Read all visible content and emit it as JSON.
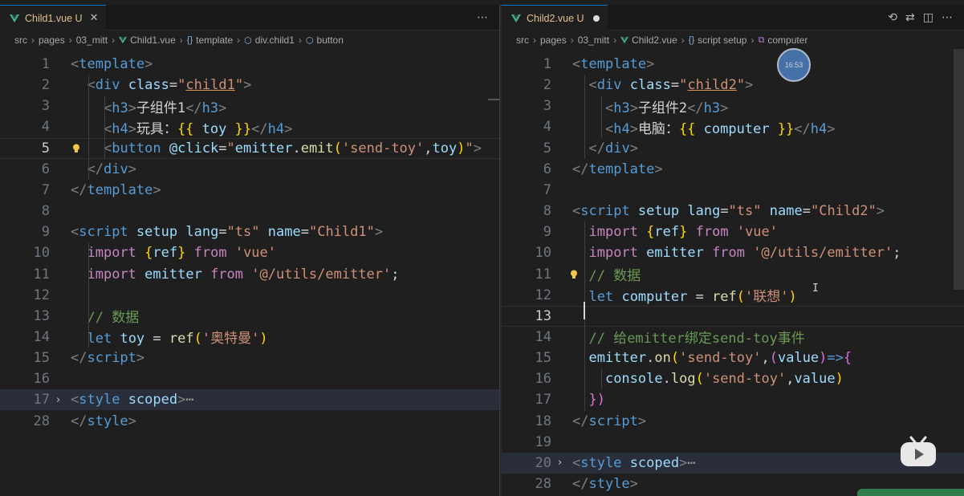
{
  "left": {
    "tab": {
      "label": "Child1.vue U",
      "close": "✕"
    },
    "actions": [
      "⋯"
    ],
    "breadcrumb": [
      {
        "label": "src"
      },
      {
        "label": "pages"
      },
      {
        "label": "03_mitt"
      },
      {
        "label": "Child1.vue",
        "icon": "vue"
      },
      {
        "label": "template",
        "icon": "{}"
      },
      {
        "label": "div.child1",
        "icon": "cube"
      },
      {
        "label": "button",
        "icon": "cube"
      }
    ],
    "lines": [
      {
        "n": "1",
        "tokens": [
          [
            "t-punc",
            "<"
          ],
          [
            "t-tag",
            "template"
          ],
          [
            "t-punc",
            ">"
          ]
        ]
      },
      {
        "n": "2",
        "tokens": [
          [
            "t-txt",
            "  "
          ],
          [
            "t-punc",
            "<"
          ],
          [
            "t-tag",
            "div"
          ],
          [
            "t-txt",
            " "
          ],
          [
            "t-attr",
            "class"
          ],
          [
            "t-txt",
            "="
          ],
          [
            "t-str",
            "\""
          ],
          [
            "t-str u-err",
            "child1"
          ],
          [
            "t-str",
            "\""
          ],
          [
            "t-punc",
            ">"
          ]
        ]
      },
      {
        "n": "3",
        "tokens": [
          [
            "t-txt",
            "    "
          ],
          [
            "t-punc",
            "<"
          ],
          [
            "t-tag",
            "h3"
          ],
          [
            "t-punc",
            ">"
          ],
          [
            "t-txt",
            "子组件1"
          ],
          [
            "t-punc",
            "</"
          ],
          [
            "t-tag",
            "h3"
          ],
          [
            "t-punc",
            ">"
          ]
        ]
      },
      {
        "n": "4",
        "tokens": [
          [
            "t-txt",
            "    "
          ],
          [
            "t-punc",
            "<"
          ],
          [
            "t-tag",
            "h4"
          ],
          [
            "t-punc",
            ">"
          ],
          [
            "t-txt",
            "玩具："
          ],
          [
            "t-brace",
            "{{"
          ],
          [
            "t-txt",
            " "
          ],
          [
            "t-var",
            "toy"
          ],
          [
            "t-txt",
            " "
          ],
          [
            "t-brace",
            "}}"
          ],
          [
            "t-punc",
            "</"
          ],
          [
            "t-tag",
            "h4"
          ],
          [
            "t-punc",
            ">"
          ]
        ]
      },
      {
        "n": "5",
        "tokens": [
          [
            "t-txt",
            "    "
          ],
          [
            "t-punc",
            "<"
          ],
          [
            "t-tag",
            "button"
          ],
          [
            "t-txt",
            " "
          ],
          [
            "t-attr",
            "@click"
          ],
          [
            "t-txt",
            "="
          ],
          [
            "t-str",
            "\""
          ],
          [
            "t-var",
            "emitter"
          ],
          [
            "t-txt",
            "."
          ],
          [
            "t-fn",
            "emit"
          ],
          [
            "t-brace",
            "("
          ],
          [
            "t-str",
            "'send-toy'"
          ],
          [
            "t-txt",
            ","
          ],
          [
            "t-var",
            "toy"
          ],
          [
            "t-brace",
            ")"
          ],
          [
            "t-str",
            "\""
          ],
          [
            "t-punc",
            ">"
          ]
        ]
      },
      {
        "n": "6",
        "tokens": [
          [
            "t-txt",
            "  "
          ],
          [
            "t-punc",
            "</"
          ],
          [
            "t-tag",
            "div"
          ],
          [
            "t-punc",
            ">"
          ]
        ]
      },
      {
        "n": "7",
        "tokens": [
          [
            "t-punc",
            "</"
          ],
          [
            "t-tag",
            "template"
          ],
          [
            "t-punc",
            ">"
          ]
        ]
      },
      {
        "n": "8",
        "tokens": []
      },
      {
        "n": "9",
        "tokens": [
          [
            "t-punc",
            "<"
          ],
          [
            "t-tag",
            "script"
          ],
          [
            "t-txt",
            " "
          ],
          [
            "t-attr",
            "setup"
          ],
          [
            "t-txt",
            " "
          ],
          [
            "t-attr",
            "lang"
          ],
          [
            "t-txt",
            "="
          ],
          [
            "t-str",
            "\"ts\""
          ],
          [
            "t-txt",
            " "
          ],
          [
            "t-attr",
            "name"
          ],
          [
            "t-txt",
            "="
          ],
          [
            "t-str",
            "\"Child1\""
          ],
          [
            "t-punc",
            ">"
          ]
        ]
      },
      {
        "n": "10",
        "tokens": [
          [
            "t-txt",
            "  "
          ],
          [
            "t-kw2",
            "import"
          ],
          [
            "t-txt",
            " "
          ],
          [
            "t-brace",
            "{"
          ],
          [
            "t-var",
            "ref"
          ],
          [
            "t-brace",
            "}"
          ],
          [
            "t-txt",
            " "
          ],
          [
            "t-kw2",
            "from"
          ],
          [
            "t-txt",
            " "
          ],
          [
            "t-str",
            "'vue'"
          ]
        ]
      },
      {
        "n": "11",
        "tokens": [
          [
            "t-txt",
            "  "
          ],
          [
            "t-kw2",
            "import"
          ],
          [
            "t-txt",
            " "
          ],
          [
            "t-var",
            "emitter"
          ],
          [
            "t-txt",
            " "
          ],
          [
            "t-kw2",
            "from"
          ],
          [
            "t-txt",
            " "
          ],
          [
            "t-str",
            "'@/utils/emitter'"
          ],
          [
            "t-txt",
            ";"
          ]
        ]
      },
      {
        "n": "12",
        "tokens": []
      },
      {
        "n": "13",
        "tokens": [
          [
            "t-txt",
            "  "
          ],
          [
            "t-com",
            "// 数据"
          ]
        ]
      },
      {
        "n": "14",
        "tokens": [
          [
            "t-txt",
            "  "
          ],
          [
            "t-kw",
            "let"
          ],
          [
            "t-txt",
            " "
          ],
          [
            "t-var",
            "toy"
          ],
          [
            "t-txt",
            " = "
          ],
          [
            "t-fn",
            "ref"
          ],
          [
            "t-brace",
            "("
          ],
          [
            "t-str",
            "'奥特曼'"
          ],
          [
            "t-brace",
            ")"
          ]
        ]
      },
      {
        "n": "15",
        "tokens": [
          [
            "t-punc",
            "</"
          ],
          [
            "t-tag",
            "script"
          ],
          [
            "t-punc",
            ">"
          ]
        ]
      },
      {
        "n": "16",
        "tokens": []
      },
      {
        "n": "17",
        "tokens": [
          [
            "t-punc",
            "<"
          ],
          [
            "t-tag",
            "style"
          ],
          [
            "t-txt",
            " "
          ],
          [
            "t-attr",
            "scoped"
          ],
          [
            "t-punc",
            ">"
          ],
          [
            "t-ellipsis",
            "⋯"
          ]
        ]
      },
      {
        "n": "28",
        "tokens": [
          [
            "t-punc",
            "</"
          ],
          [
            "t-tag",
            "style"
          ],
          [
            "t-punc",
            ">"
          ]
        ]
      }
    ]
  },
  "right": {
    "tab": {
      "label": "Child2.vue U"
    },
    "actions": [
      "⟲",
      "⇄",
      "◫",
      "⋯"
    ],
    "breadcrumb": [
      {
        "label": "src"
      },
      {
        "label": "pages"
      },
      {
        "label": "03_mitt"
      },
      {
        "label": "Child2.vue",
        "icon": "vue"
      },
      {
        "label": "script setup",
        "icon": "{}"
      },
      {
        "label": "computer",
        "icon": "var"
      }
    ],
    "lines": [
      {
        "n": "1",
        "tokens": [
          [
            "t-punc",
            "<"
          ],
          [
            "t-tag",
            "template"
          ],
          [
            "t-punc",
            ">"
          ]
        ]
      },
      {
        "n": "2",
        "tokens": [
          [
            "t-txt",
            "  "
          ],
          [
            "t-punc",
            "<"
          ],
          [
            "t-tag",
            "div"
          ],
          [
            "t-txt",
            " "
          ],
          [
            "t-attr",
            "class"
          ],
          [
            "t-txt",
            "="
          ],
          [
            "t-str",
            "\""
          ],
          [
            "t-str u-err",
            "child2"
          ],
          [
            "t-str",
            "\""
          ],
          [
            "t-punc",
            ">"
          ]
        ]
      },
      {
        "n": "3",
        "tokens": [
          [
            "t-txt",
            "    "
          ],
          [
            "t-punc",
            "<"
          ],
          [
            "t-tag",
            "h3"
          ],
          [
            "t-punc",
            ">"
          ],
          [
            "t-txt",
            "子组件2"
          ],
          [
            "t-punc",
            "</"
          ],
          [
            "t-tag",
            "h3"
          ],
          [
            "t-punc",
            ">"
          ]
        ]
      },
      {
        "n": "4",
        "tokens": [
          [
            "t-txt",
            "    "
          ],
          [
            "t-punc",
            "<"
          ],
          [
            "t-tag",
            "h4"
          ],
          [
            "t-punc",
            ">"
          ],
          [
            "t-txt",
            "电脑："
          ],
          [
            "t-brace",
            "{{"
          ],
          [
            "t-txt",
            " "
          ],
          [
            "t-var",
            "computer"
          ],
          [
            "t-txt",
            " "
          ],
          [
            "t-brace",
            "}}"
          ],
          [
            "t-punc",
            "</"
          ],
          [
            "t-tag",
            "h4"
          ],
          [
            "t-punc",
            ">"
          ]
        ]
      },
      {
        "n": "5",
        "tokens": [
          [
            "t-txt",
            "  "
          ],
          [
            "t-punc",
            "</"
          ],
          [
            "t-tag",
            "div"
          ],
          [
            "t-punc",
            ">"
          ]
        ]
      },
      {
        "n": "6",
        "tokens": [
          [
            "t-punc",
            "</"
          ],
          [
            "t-tag",
            "template"
          ],
          [
            "t-punc",
            ">"
          ]
        ]
      },
      {
        "n": "7",
        "tokens": []
      },
      {
        "n": "8",
        "tokens": [
          [
            "t-punc",
            "<"
          ],
          [
            "t-tag",
            "script"
          ],
          [
            "t-txt",
            " "
          ],
          [
            "t-attr",
            "setup"
          ],
          [
            "t-txt",
            " "
          ],
          [
            "t-attr",
            "lang"
          ],
          [
            "t-txt",
            "="
          ],
          [
            "t-str",
            "\"ts\""
          ],
          [
            "t-txt",
            " "
          ],
          [
            "t-attr",
            "name"
          ],
          [
            "t-txt",
            "="
          ],
          [
            "t-str",
            "\"Child2\""
          ],
          [
            "t-punc",
            ">"
          ]
        ]
      },
      {
        "n": "9",
        "tokens": [
          [
            "t-txt",
            "  "
          ],
          [
            "t-kw2",
            "import"
          ],
          [
            "t-txt",
            " "
          ],
          [
            "t-brace",
            "{"
          ],
          [
            "t-var",
            "ref"
          ],
          [
            "t-brace",
            "}"
          ],
          [
            "t-txt",
            " "
          ],
          [
            "t-kw2",
            "from"
          ],
          [
            "t-txt",
            " "
          ],
          [
            "t-str",
            "'vue'"
          ]
        ]
      },
      {
        "n": "10",
        "tokens": [
          [
            "t-txt",
            "  "
          ],
          [
            "t-kw2",
            "import"
          ],
          [
            "t-txt",
            " "
          ],
          [
            "t-var",
            "emitter"
          ],
          [
            "t-txt",
            " "
          ],
          [
            "t-kw2",
            "from"
          ],
          [
            "t-txt",
            " "
          ],
          [
            "t-str",
            "'@/utils/emitter'"
          ],
          [
            "t-txt",
            ";"
          ]
        ]
      },
      {
        "n": "11",
        "tokens": [
          [
            "t-txt",
            "  "
          ],
          [
            "t-com",
            "// 数据"
          ]
        ]
      },
      {
        "n": "12",
        "tokens": [
          [
            "t-txt",
            "  "
          ],
          [
            "t-kw",
            "let"
          ],
          [
            "t-txt",
            " "
          ],
          [
            "t-var",
            "computer"
          ],
          [
            "t-txt",
            " = "
          ],
          [
            "t-fn",
            "ref"
          ],
          [
            "t-brace",
            "("
          ],
          [
            "t-str",
            "'联想'"
          ],
          [
            "t-brace",
            ")"
          ]
        ]
      },
      {
        "n": "13",
        "tokens": []
      },
      {
        "n": "14",
        "tokens": [
          [
            "t-txt",
            "  "
          ],
          [
            "t-com",
            "// 给emitter绑定send-toy事件"
          ]
        ]
      },
      {
        "n": "15",
        "tokens": [
          [
            "t-txt",
            "  "
          ],
          [
            "t-var",
            "emitter"
          ],
          [
            "t-txt",
            "."
          ],
          [
            "t-fn",
            "on"
          ],
          [
            "t-brace",
            "("
          ],
          [
            "t-str",
            "'send-toy'"
          ],
          [
            "t-txt",
            ","
          ],
          [
            "t-brace2",
            "("
          ],
          [
            "t-var",
            "value"
          ],
          [
            "t-brace2",
            ")"
          ],
          [
            "t-kw",
            "=>"
          ],
          [
            "t-brace2",
            "{"
          ]
        ]
      },
      {
        "n": "16",
        "tokens": [
          [
            "t-txt",
            "    "
          ],
          [
            "t-var",
            "console"
          ],
          [
            "t-txt",
            "."
          ],
          [
            "t-fn",
            "log"
          ],
          [
            "t-brace",
            "("
          ],
          [
            "t-str",
            "'send-toy'"
          ],
          [
            "t-txt",
            ","
          ],
          [
            "t-var",
            "value"
          ],
          [
            "t-brace",
            ")"
          ]
        ]
      },
      {
        "n": "17",
        "tokens": [
          [
            "t-txt",
            "  "
          ],
          [
            "t-brace2",
            "})"
          ]
        ]
      },
      {
        "n": "18",
        "tokens": [
          [
            "t-punc",
            "</"
          ],
          [
            "t-tag",
            "script"
          ],
          [
            "t-punc",
            ">"
          ]
        ]
      },
      {
        "n": "19",
        "tokens": []
      },
      {
        "n": "20",
        "tokens": [
          [
            "t-punc",
            "<"
          ],
          [
            "t-tag",
            "style"
          ],
          [
            "t-txt",
            " "
          ],
          [
            "t-attr",
            "scoped"
          ],
          [
            "t-punc",
            ">"
          ],
          [
            "t-ellipsis",
            "⋯"
          ]
        ]
      },
      {
        "n": "28",
        "tokens": [
          [
            "t-punc",
            "</"
          ],
          [
            "t-tag",
            "style"
          ],
          [
            "t-punc",
            ">"
          ]
        ]
      }
    ]
  },
  "overlay": {
    "clock": "16:53",
    "ibeam": "I"
  },
  "colors": {
    "accent": "#0078d4",
    "modified": "#e2c08d",
    "vue": "#42b883"
  }
}
